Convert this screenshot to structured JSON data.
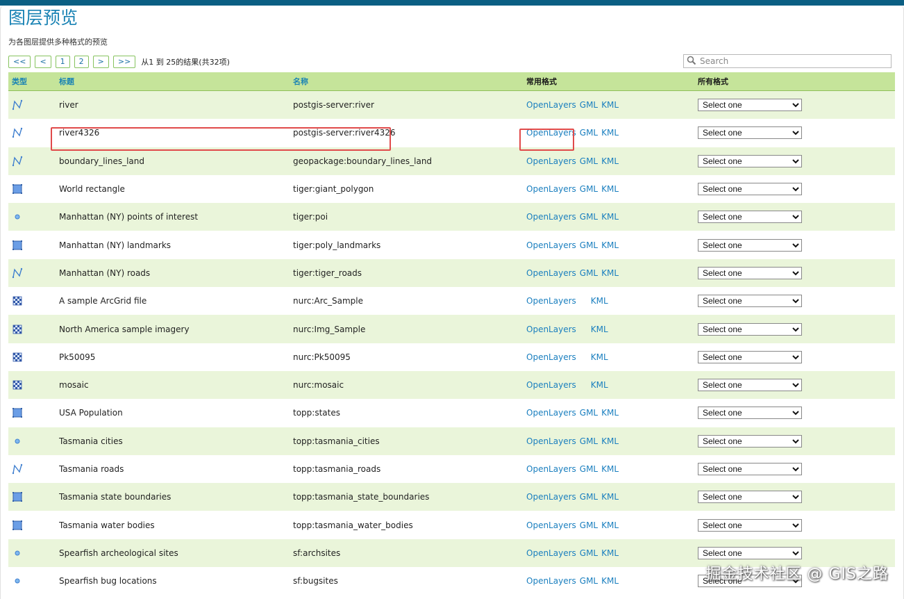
{
  "header": {
    "title": "图层预览",
    "subtitle": "为各图层提供多种格式的预览"
  },
  "pager": {
    "first": "<<",
    "prev": "<",
    "page1": "1",
    "page2": "2",
    "next": ">",
    "last": ">>",
    "info": "从1 到 25的结果(共32项)"
  },
  "search": {
    "placeholder": "Search"
  },
  "columns": {
    "type": "类型",
    "title": "标题",
    "name": "名称",
    "common": "常用格式",
    "all": "所有格式"
  },
  "format_labels": {
    "openlayers": "OpenLayers",
    "gml": "GML",
    "kml": "KML"
  },
  "select_label": "Select one",
  "layers": [
    {
      "type": "line-icon",
      "title": "river",
      "name": "postgis-server:river",
      "gml": true
    },
    {
      "type": "line-icon",
      "title": "river4326",
      "name": "postgis-server:river4326",
      "gml": true
    },
    {
      "type": "line-icon",
      "title": "boundary_lines_land",
      "name": "geopackage:boundary_lines_land",
      "gml": true
    },
    {
      "type": "polygon-icon",
      "title": "World rectangle",
      "name": "tiger:giant_polygon",
      "gml": true
    },
    {
      "type": "point-icon",
      "title": "Manhattan (NY) points of interest",
      "name": "tiger:poi",
      "gml": true
    },
    {
      "type": "polygon-icon",
      "title": "Manhattan (NY) landmarks",
      "name": "tiger:poly_landmarks",
      "gml": true
    },
    {
      "type": "line-icon",
      "title": "Manhattan (NY) roads",
      "name": "tiger:tiger_roads",
      "gml": true
    },
    {
      "type": "raster-icon",
      "title": "A sample ArcGrid file",
      "name": "nurc:Arc_Sample",
      "gml": false
    },
    {
      "type": "raster-icon",
      "title": "North America sample imagery",
      "name": "nurc:Img_Sample",
      "gml": false
    },
    {
      "type": "raster-icon",
      "title": "Pk50095",
      "name": "nurc:Pk50095",
      "gml": false
    },
    {
      "type": "raster-icon",
      "title": "mosaic",
      "name": "nurc:mosaic",
      "gml": false
    },
    {
      "type": "polygon-icon",
      "title": "USA Population",
      "name": "topp:states",
      "gml": true
    },
    {
      "type": "point-icon",
      "title": "Tasmania cities",
      "name": "topp:tasmania_cities",
      "gml": true
    },
    {
      "type": "line-icon",
      "title": "Tasmania roads",
      "name": "topp:tasmania_roads",
      "gml": true
    },
    {
      "type": "polygon-icon",
      "title": "Tasmania state boundaries",
      "name": "topp:tasmania_state_boundaries",
      "gml": true
    },
    {
      "type": "polygon-icon",
      "title": "Tasmania water bodies",
      "name": "topp:tasmania_water_bodies",
      "gml": true
    },
    {
      "type": "point-icon",
      "title": "Spearfish archeological sites",
      "name": "sf:archsites",
      "gml": true
    },
    {
      "type": "point-icon",
      "title": "Spearfish bug locations",
      "name": "sf:bugsites",
      "gml": true
    }
  ],
  "watermark": "掘金技术社区 @ GIS之路",
  "colors": {
    "accent": "#1a83b4",
    "header_row": "#c5e49a",
    "odd_row": "#eaf5da",
    "highlight": "#e04a4a",
    "topbar": "#0b5f83"
  }
}
